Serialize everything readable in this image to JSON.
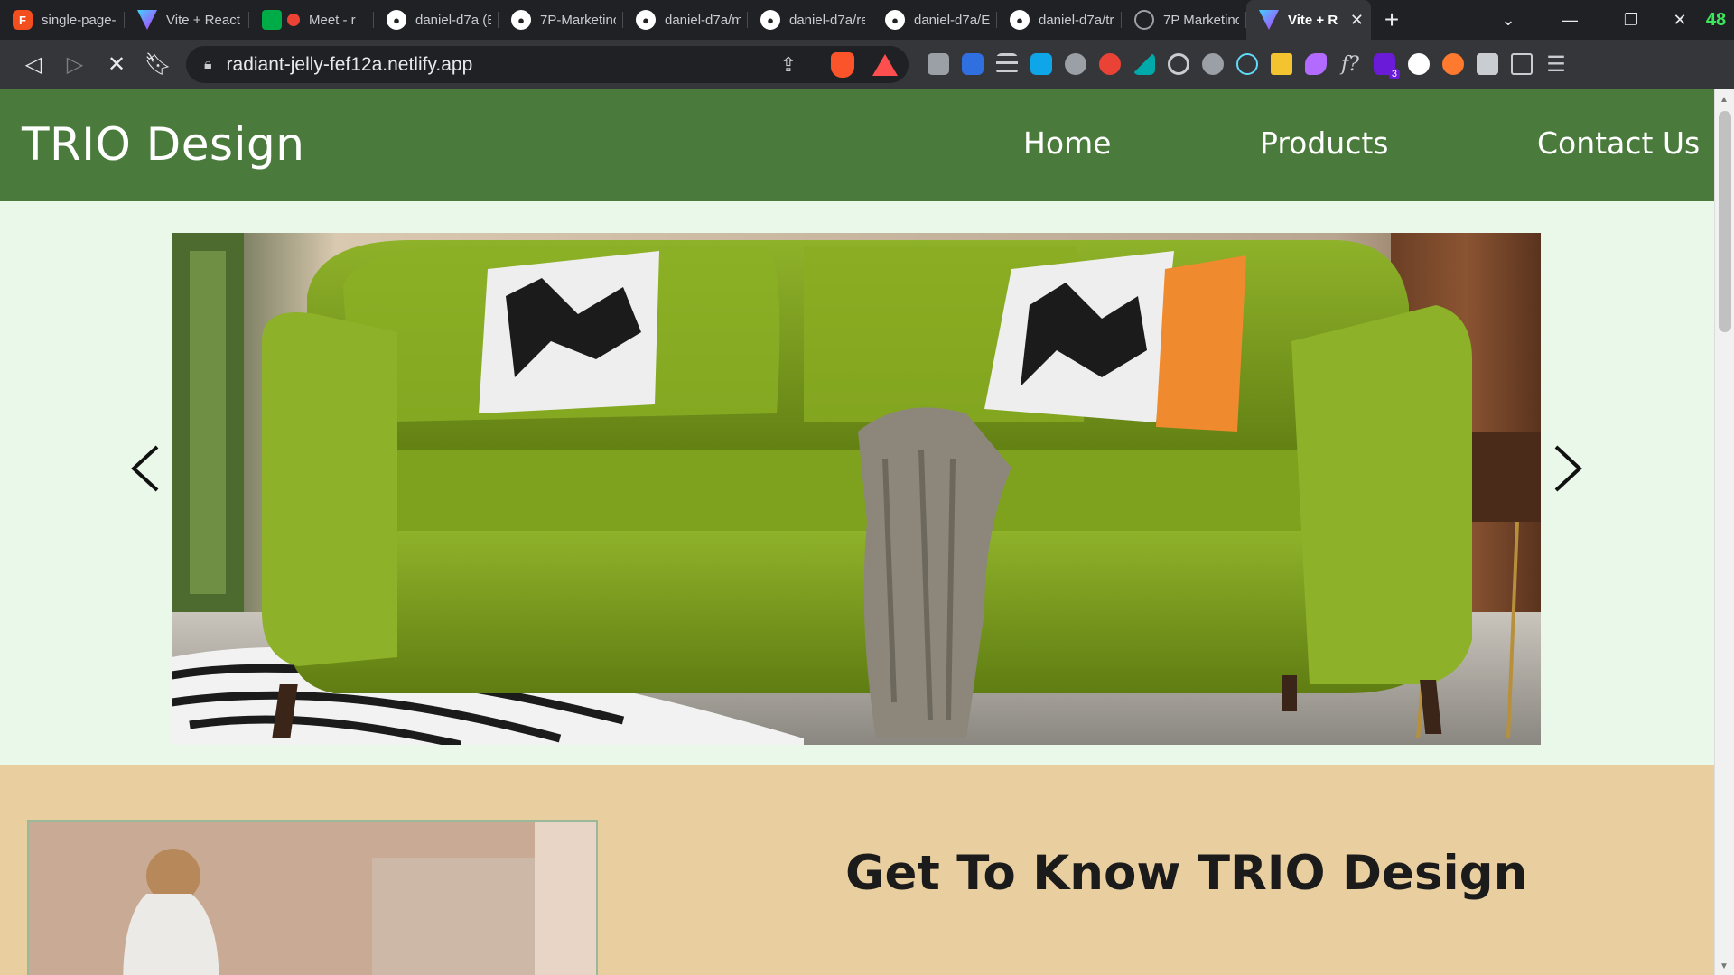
{
  "browser": {
    "tabs": [
      {
        "title": "single-page-",
        "icon": "figma-icon",
        "color": "#f24e1e"
      },
      {
        "title": "Vite + React",
        "icon": "vite-icon",
        "color": "#bd34fe"
      },
      {
        "title": "Meet - r",
        "icon": "meet-icon",
        "color": "#00ac47"
      },
      {
        "title": "daniel-d7a (E",
        "icon": "github-icon",
        "color": "#ffffff"
      },
      {
        "title": "7P-Marketinc",
        "icon": "github-icon",
        "color": "#ffffff"
      },
      {
        "title": "daniel-d7a/m",
        "icon": "github-icon",
        "color": "#ffffff"
      },
      {
        "title": "daniel-d7a/re",
        "icon": "github-icon",
        "color": "#ffffff"
      },
      {
        "title": "daniel-d7a/E",
        "icon": "github-icon",
        "color": "#ffffff"
      },
      {
        "title": "daniel-d7a/tr",
        "icon": "github-icon",
        "color": "#ffffff"
      },
      {
        "title": "7P Marketinc",
        "icon": "netlify-icon",
        "color": "#9aa0a6"
      },
      {
        "title": "Vite + R",
        "icon": "vite-icon",
        "color": "#bd34fe"
      }
    ],
    "window_badge": "48",
    "url": "radiant-jelly-fef12a.netlify.app",
    "extension_badge": "3"
  },
  "site": {
    "brand": "TRIO Design",
    "nav": {
      "home": "Home",
      "products": "Products",
      "contact": "Contact Us"
    },
    "about_title": "Get To Know TRIO Design",
    "colors": {
      "header": "#4a7b3c",
      "hero_bg": "#e9f8e8",
      "about_bg": "#e9cf9f",
      "sofa": "#7f9f1e"
    }
  }
}
